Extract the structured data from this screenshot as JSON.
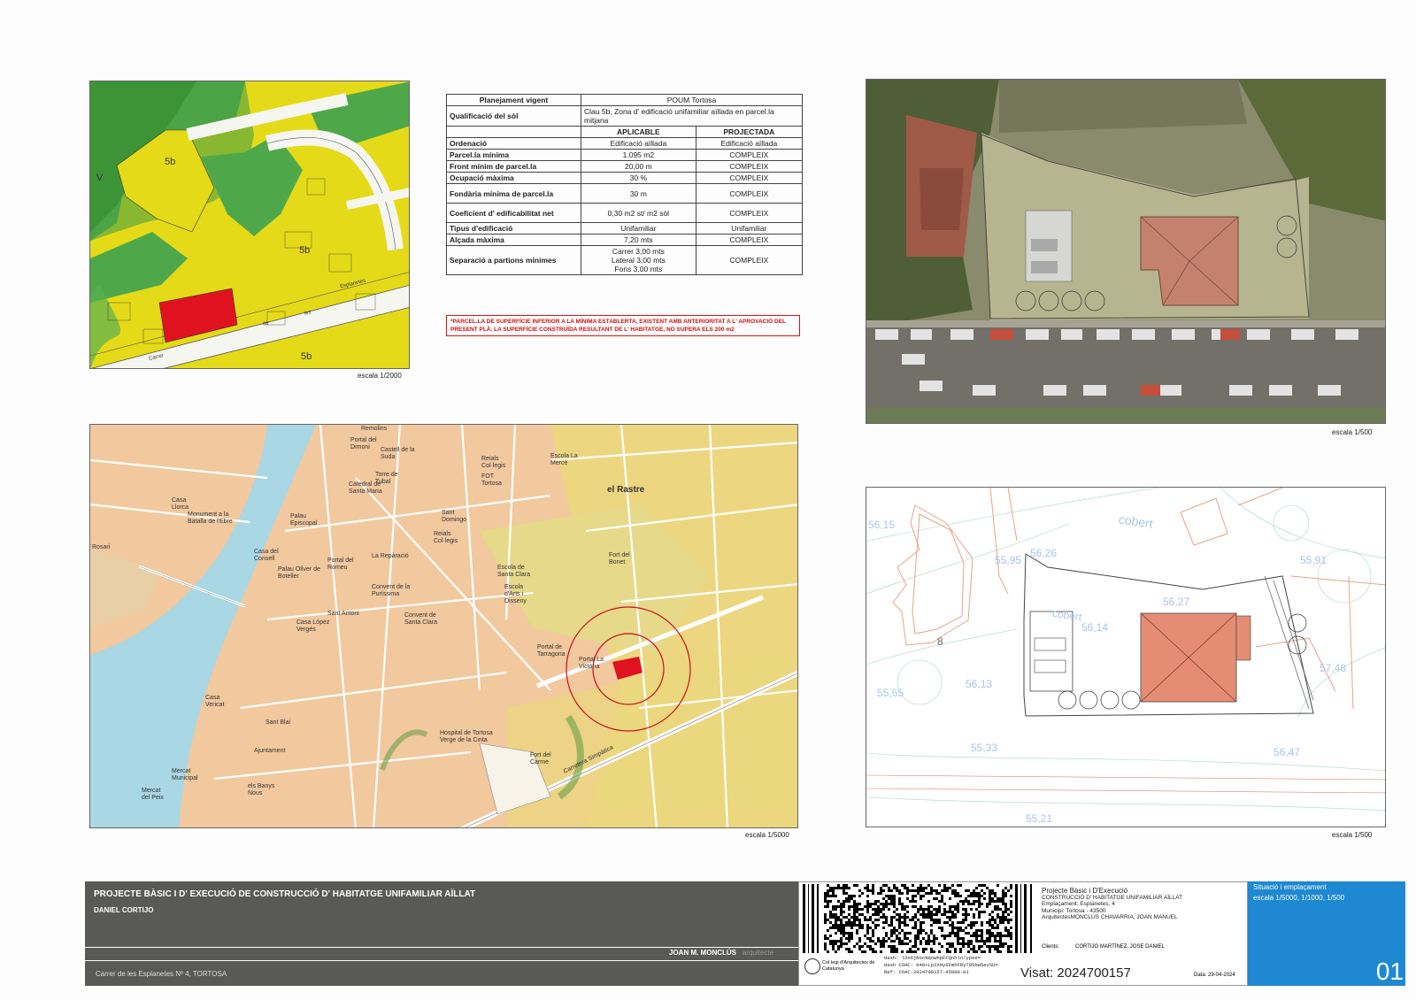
{
  "zoning_map": {
    "labels": [
      "5b",
      "V",
      "5b",
      "5b"
    ],
    "streets": [
      "Carrer",
      "de",
      "les",
      "Esplanetes"
    ],
    "scale": "escala 1/2000"
  },
  "params_table": {
    "planejament_label": "Planejament vigent",
    "planejament_value": "POUM Tortosa",
    "qualificacio_label": "Qualificació del sòl",
    "qualificacio_value": "Clau 5b, Zona d' edificació unifamiliar aïllada en parcel.la mitjana",
    "col_aplicable": "APLICABLE",
    "col_projectada": "PROJECTADA",
    "rows": [
      {
        "label": "Ordenació",
        "aplicable": "Edificació aïllada",
        "projectada": "Edificació aïllada"
      },
      {
        "label": "Parcel.la mínima",
        "aplicable": "1.095 m2",
        "projectada": "COMPLEIX"
      },
      {
        "label": "Front mínim de parcel.la",
        "aplicable": "20,00 m",
        "projectada": "COMPLEIX"
      },
      {
        "label": "Ocupació màxima",
        "aplicable": "30 %",
        "projectada": "COMPLEIX"
      },
      {
        "label": "Fondària mínima de parcel.la",
        "aplicable": "30 m",
        "projectada": "COMPLEIX"
      },
      {
        "label": "Coeficient d' edificabilitat net",
        "aplicable": "0,30 m2 st/ m2 sòl",
        "projectada": "COMPLEIX"
      },
      {
        "label": "Tipus d'edificació",
        "aplicable": "Unifamiliar",
        "projectada": "Unifamiliar"
      },
      {
        "label": "Alçada màxima",
        "aplicable": "7,20 mts",
        "projectada": "COMPLEIX"
      }
    ],
    "separacio_label": "Separació a partions mínimes",
    "separacio_lines": [
      "Carrer 3,00 mts",
      "Lateral 3,00 mts",
      "Fons 3,00 mts"
    ],
    "separacio_projectada": "COMPLEIX"
  },
  "note": "*PARCEL.LA DE SUPERFÍCIE INFERIOR A LA MÍNIMA ESTABLERTA, EXISTENT AMB ANTERIORITAT A L' APROVACIÓ DEL PRESENT PLÀ. LA SUPERFÍCIE CONSTRUÏDA RESULTANT DE L' HABITATGE, NO SUPERA ELS 200 m2",
  "aerial": {
    "scale": "escala 1/500"
  },
  "city_map": {
    "labels": [
      "Castell de la Suda",
      "Catedral de Santa Maria",
      "el Rastre",
      "Fort del Bonet",
      "Portal de Tarragona",
      "Portal La Victòria",
      "Hospital de Tortosa Verge de la Cinta",
      "Fort del Carme",
      "Carretera Simpàtica",
      "Monument a la Batalla de l'Ebre",
      "Palau Episcopal",
      "Casa del Consell",
      "Palau Oliver de Boteller",
      "Portal del Romeu",
      "La Repàració",
      "Convent de la Puríssima",
      "Convent de Santa Clara",
      "Casa López Vergés",
      "Sant Antoni",
      "Sant Domingo",
      "Reials Col·legis",
      "Escola de Santa Clara",
      "Mercat Municipal",
      "Ajuntament",
      "Sant Blai",
      "Casa Vericat",
      "Mercat del Peix",
      "Casa Llorca",
      "Remolins",
      "Escola d'Arts i Disseny",
      "Portal del Dimoni",
      "Torre de Tubal",
      "Reials Col·legis",
      "FOT Tortosa",
      "Escola La Mercè",
      "els Banys Nous",
      "Rosari"
    ],
    "scale": "escala 1/5000"
  },
  "site_plan": {
    "elevations": [
      "56,15",
      "55,95",
      "56,26",
      "56,27",
      "56,14",
      "55,91",
      "56,13",
      "55,65",
      "55,33",
      "56,47",
      "57,48",
      "55,21"
    ],
    "labels": [
      "cobert",
      "cobert",
      "8"
    ],
    "scale": "escala 1/500"
  },
  "title_block": {
    "project_title": "PROJECTE BÀSIC I D' EXECUCIÓ DE CONSTRUCCIÓ D' HABITATGE UNIFAMILIAR AÏLLAT",
    "client": "DANIEL CORTIJO",
    "architect": "JOAN M. MONCLÚS",
    "architect_suffix": "arquitecte",
    "address": "Carrer de les  Esplanetes Nº 4, TORTOSA",
    "stamp_lines": [
      "Projecte Bàsic i D'Execució",
      "CONSTRUCCIÓ D' HABITATGE UNIFAMILIAR AÏLLAT",
      "Emplaçament: Esplanetes, 4",
      "Municipi: Tortosa - 43500",
      "ArquitectesMONCLÚS CHAVARRIA, JOAN MANUEL"
    ],
    "clients_label": "Clients:",
    "clients_value": "CORTIJO MARTÍNEZ, JOSE DANIEL",
    "hash_lines": [
      "Hash: lXn6jRocNqowhpFFQnhln/ypse=",
      "Hash COAC: b48+Lp2XHy6FmhFRyT95bw5evSU=",
      "Ref: COAC-2024700157-45800-01"
    ],
    "college": "Col·legi d'Arquitectes de Catalunya",
    "visat": "Visat: 2024700157",
    "data_label": "Data: 29-04-2024",
    "sheet_title": "Situació i emplaçament",
    "sheet_scale": "escala 1/5000, 1/1000, 1/500",
    "sheet_number": "01"
  },
  "colors": {
    "zone_yellow": "#e6db1a",
    "zone_green": "#4ea84a",
    "plot_red": "#e0121f",
    "title_bar": "#595957",
    "sheet_blue": "#1e88d2",
    "map_orange": "#f2c8a0",
    "river": "#a9d7e3"
  }
}
